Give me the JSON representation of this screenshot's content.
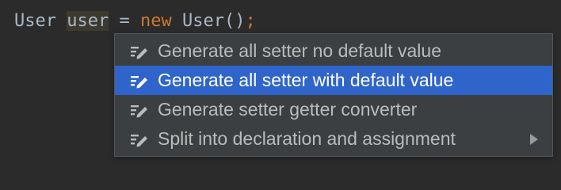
{
  "editor": {
    "code_tokens": {
      "type_name": "User",
      "space1": " ",
      "variable": "user",
      "assign": " = ",
      "keyword_new": "new",
      "space2": " ",
      "constructor": "User()",
      "semicolon": ";"
    }
  },
  "intention_menu": {
    "items": [
      {
        "label": "Generate all setter no default value",
        "icon": "intention-edit-icon",
        "selected": false
      },
      {
        "label": "Generate all setter with default value",
        "icon": "intention-edit-icon",
        "selected": true
      },
      {
        "label": "Generate setter getter converter",
        "icon": "intention-edit-icon",
        "selected": false
      },
      {
        "label": "Split into declaration and assignment",
        "icon": "intention-edit-icon",
        "selected": false,
        "has_submenu": true
      }
    ]
  },
  "colors": {
    "editor_background": "#2b2b2b",
    "popup_background": "#3c3f41",
    "selection": "#2f65ca",
    "keyword": "#cc7832",
    "text": "#a9b7c6"
  }
}
